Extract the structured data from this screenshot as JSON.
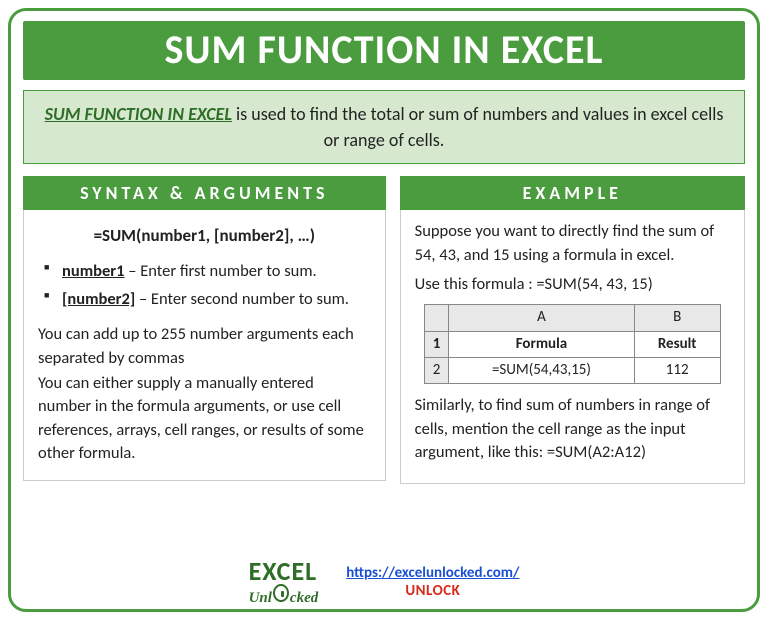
{
  "title": "SUM FUNCTION IN EXCEL",
  "description": {
    "lead": "SUM FUNCTION IN EXCEL",
    "rest": " is used to find the total or sum of numbers and values in excel cells or range of cells."
  },
  "syntax": {
    "heading": "SYNTAX & ARGUMENTS",
    "formula": "=SUM(number1, [number2], …)",
    "args": [
      {
        "name": "number1",
        "desc": " – Enter first number to sum."
      },
      {
        "name": "[number2]",
        "desc": " – Enter second number to sum."
      }
    ],
    "note1": "You can add up to 255 number arguments each separated by commas",
    "note2": "You can either supply a manually entered number in the formula arguments, or use cell references, arrays, cell ranges, or results of some other formula."
  },
  "example": {
    "heading": "EXAMPLE",
    "intro": "Suppose you want to directly find the sum of 54, 43, and 15 using a formula in excel.",
    "use_line": "Use this formula : =SUM(54, 43, 15)",
    "table": {
      "cols": [
        "A",
        "B"
      ],
      "header_row": [
        "Formula",
        "Result"
      ],
      "data_row": [
        "=SUM(54,43,15)",
        "112"
      ]
    },
    "outro": "Similarly, to find sum of numbers in range of cells, mention the cell range as the input argument, like this: =SUM(A2:A12)"
  },
  "footer": {
    "logo_big": "EXCEL",
    "logo_small": "Unl  cked",
    "url": "https://excelunlocked.com/",
    "unlock": "UNLOCK"
  }
}
